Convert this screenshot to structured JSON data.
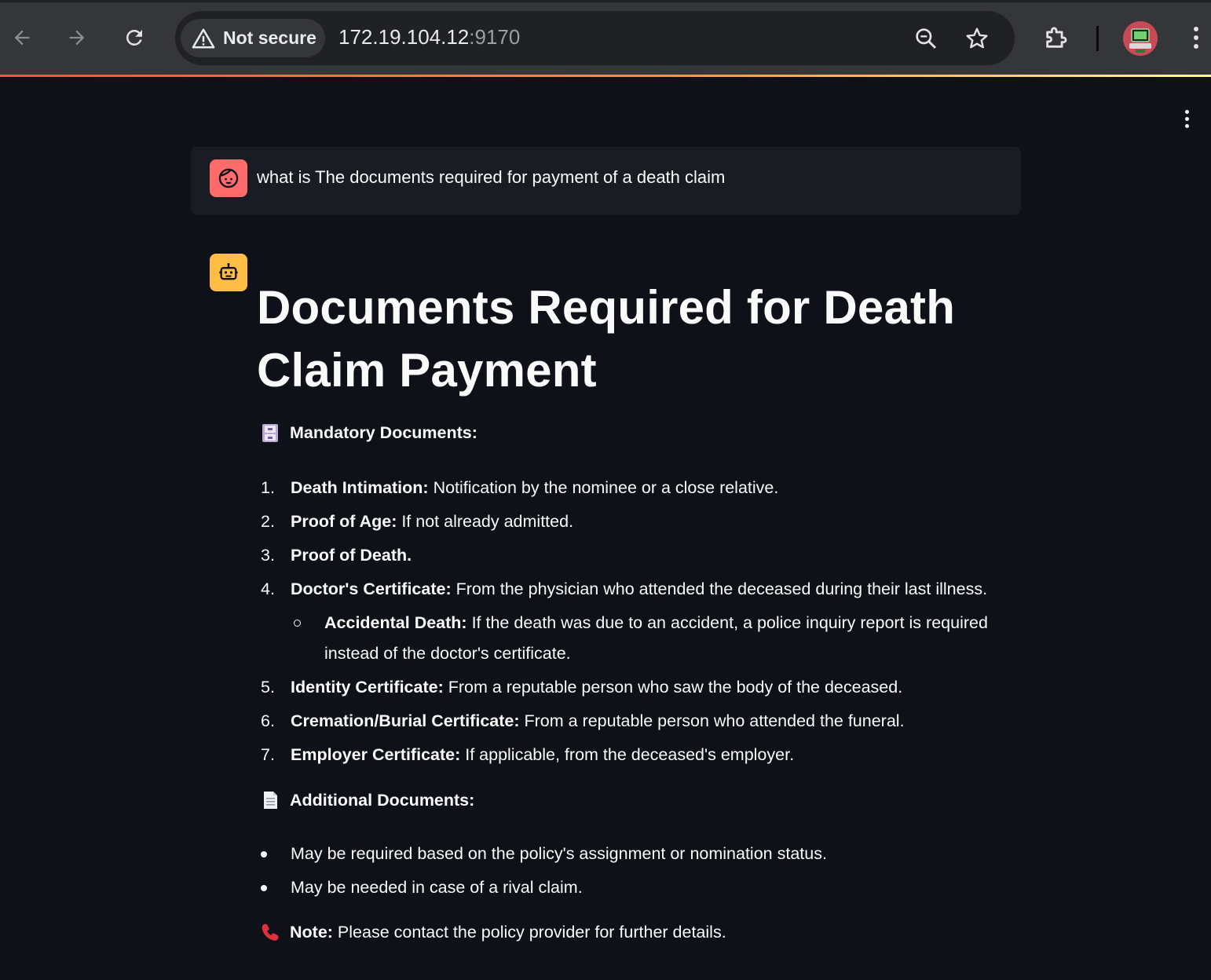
{
  "browser": {
    "security_label": "Not secure",
    "url_host": "172.19.104.12",
    "url_port": ":9170"
  },
  "chat": {
    "user_message": "what is The documents required for payment of a death claim",
    "answer": {
      "title": "Documents Required for Death Claim Payment",
      "mandatory_heading": "Mandatory Documents:",
      "mandatory_items": [
        {
          "number": "1.",
          "label": "Death Intimation:",
          "text": " Notification by the nominee or a close relative."
        },
        {
          "number": "2.",
          "label": "Proof of Age:",
          "text": " If not already admitted."
        },
        {
          "number": "3.",
          "label": "Proof of Death.",
          "text": ""
        },
        {
          "number": "4.",
          "label": "Doctor's Certificate:",
          "text": " From the physician who attended the deceased during their last illness."
        },
        {
          "number": "5.",
          "label": "Identity Certificate:",
          "text": " From a reputable person who saw the body of the deceased."
        },
        {
          "number": "6.",
          "label": "Cremation/Burial Certificate:",
          "text": " From a reputable person who attended the funeral."
        },
        {
          "number": "7.",
          "label": "Employer Certificate:",
          "text": " If applicable, from the deceased's employer."
        }
      ],
      "sub_item": {
        "label": "Accidental Death:",
        "text": " If the death was due to an accident, a police inquiry report is required instead of the doctor's certificate."
      },
      "additional_heading": "Additional Documents:",
      "additional_items": [
        "May be required based on the policy's assignment or nomination status.",
        "May be needed in case of a rival claim."
      ],
      "note_label": "Note:",
      "note_text": " Please contact the policy provider for further details."
    }
  },
  "colors": {
    "app_background": "#0e1117",
    "user_message_background": "#1a1c24",
    "user_avatar": "#ff6b6b",
    "assistant_avatar": "#ffbd45",
    "text": "#fafafa"
  },
  "icons": {
    "back": "arrow-left-icon",
    "forward": "arrow-right-icon",
    "reload": "reload-icon",
    "warning": "warning-triangle-icon",
    "zoom": "zoom-icon",
    "bookmark": "star-icon",
    "extensions": "puzzle-icon",
    "menu": "kebab-menu-icon",
    "user_avatar": "face-icon",
    "assistant_avatar": "robot-icon",
    "mandatory": "file-cabinet-emoji",
    "additional": "page-facing-up-emoji",
    "note": "telephone-receiver-emoji"
  }
}
